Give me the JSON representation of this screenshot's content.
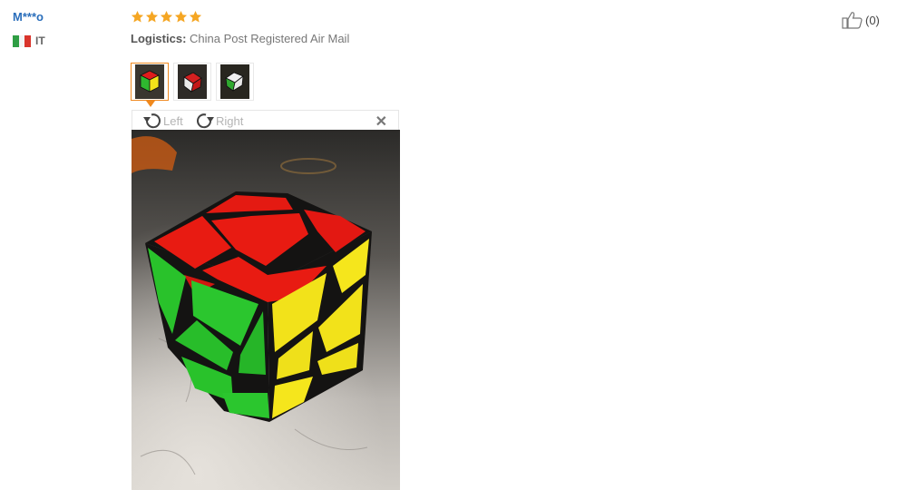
{
  "review": {
    "user_name": "M***o",
    "country_code": "IT",
    "rating": 5,
    "logistics_label": "Logistics:",
    "logistics_value": "China Post Registered Air Mail",
    "like_count": "(0)"
  },
  "viewer": {
    "rotate_left_label": "Left",
    "rotate_right_label": "Right",
    "close_icon": "close-icon"
  },
  "colors": {
    "star": "#f5a623",
    "username": "#2a6ebb",
    "active_thumb_border": "#f0891e"
  }
}
